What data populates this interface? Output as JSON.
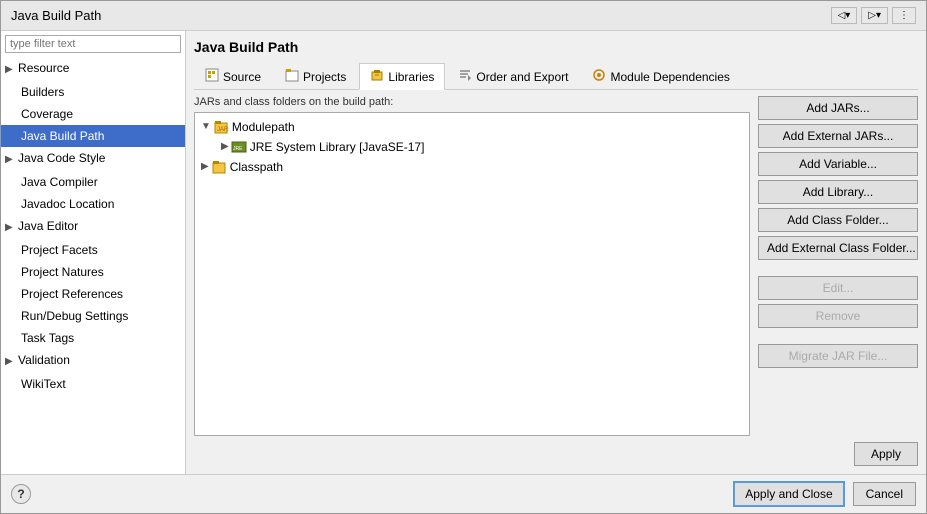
{
  "dialog": {
    "title": "Java Build Path",
    "filter_placeholder": "type filter text"
  },
  "sidebar": {
    "items": [
      {
        "id": "resource",
        "label": "Resource",
        "indent": 1,
        "has_arrow": true,
        "selected": false
      },
      {
        "id": "builders",
        "label": "Builders",
        "indent": 2,
        "has_arrow": false,
        "selected": false
      },
      {
        "id": "coverage",
        "label": "Coverage",
        "indent": 2,
        "has_arrow": false,
        "selected": false
      },
      {
        "id": "java-build-path",
        "label": "Java Build Path",
        "indent": 2,
        "has_arrow": false,
        "selected": true
      },
      {
        "id": "java-code-style",
        "label": "Java Code Style",
        "indent": 1,
        "has_arrow": true,
        "selected": false
      },
      {
        "id": "java-compiler",
        "label": "Java Compiler",
        "indent": 2,
        "has_arrow": false,
        "selected": false
      },
      {
        "id": "javadoc-location",
        "label": "Javadoc Location",
        "indent": 2,
        "has_arrow": false,
        "selected": false
      },
      {
        "id": "java-editor",
        "label": "Java Editor",
        "indent": 1,
        "has_arrow": true,
        "selected": false
      },
      {
        "id": "project-facets",
        "label": "Project Facets",
        "indent": 2,
        "has_arrow": false,
        "selected": false
      },
      {
        "id": "project-natures",
        "label": "Project Natures",
        "indent": 2,
        "has_arrow": false,
        "selected": false
      },
      {
        "id": "project-references",
        "label": "Project References",
        "indent": 2,
        "has_arrow": false,
        "selected": false
      },
      {
        "id": "run-debug-settings",
        "label": "Run/Debug Settings",
        "indent": 2,
        "has_arrow": false,
        "selected": false
      },
      {
        "id": "task-tags",
        "label": "Task Tags",
        "indent": 2,
        "has_arrow": false,
        "selected": false
      },
      {
        "id": "validation",
        "label": "Validation",
        "indent": 1,
        "has_arrow": true,
        "selected": false
      },
      {
        "id": "wikitext",
        "label": "WikiText",
        "indent": 2,
        "has_arrow": false,
        "selected": false
      }
    ]
  },
  "tabs": [
    {
      "id": "source",
      "label": "Source",
      "icon": "source-icon",
      "active": false
    },
    {
      "id": "projects",
      "label": "Projects",
      "icon": "projects-icon",
      "active": false
    },
    {
      "id": "libraries",
      "label": "Libraries",
      "icon": "libraries-icon",
      "active": true
    },
    {
      "id": "order-export",
      "label": "Order and Export",
      "icon": "order-icon",
      "active": false
    },
    {
      "id": "module-deps",
      "label": "Module Dependencies",
      "icon": "module-icon",
      "active": false
    }
  ],
  "description": "JARs and class folders on the build path:",
  "tree": {
    "modulepath": {
      "label": "Modulepath",
      "expanded": true,
      "children": [
        {
          "label": "JRE System Library [JavaSE-17]",
          "type": "jre"
        }
      ]
    },
    "classpath": {
      "label": "Classpath",
      "expanded": false
    }
  },
  "buttons": {
    "add_jars": "Add JARs...",
    "add_external_jars": "Add External JARs...",
    "add_variable": "Add Variable...",
    "add_library": "Add Library...",
    "add_class_folder": "Add Class Folder...",
    "add_external_class_folder": "Add External Class Folder...",
    "edit": "Edit...",
    "remove": "Remove",
    "migrate_jar": "Migrate JAR File..."
  },
  "footer": {
    "apply": "Apply",
    "apply_close": "Apply and Close",
    "cancel": "Cancel"
  }
}
